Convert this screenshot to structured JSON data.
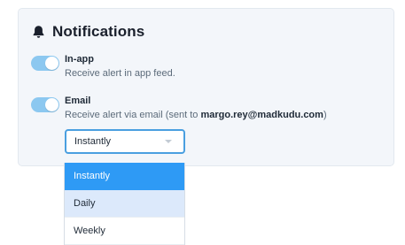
{
  "notifications": {
    "title": "Notifications",
    "title_icon": "bell-icon",
    "inapp": {
      "label": "In-app",
      "description": "Receive alert in app feed.",
      "enabled": true
    },
    "email": {
      "label": "Email",
      "description_prefix": "Receive alert via email (sent to ",
      "address": "margo.rey@madkudu.com",
      "description_suffix": ")",
      "enabled": true
    },
    "frequency": {
      "selected": "Instantly",
      "options": [
        "Instantly",
        "Daily",
        "Weekly"
      ]
    }
  },
  "colors": {
    "toggle_on": "#8cc8f0",
    "select_border": "#4a9fe0",
    "option_selected": "#2e9af5",
    "option_hover": "#dce9fb",
    "card_bg": "#f3f6fa"
  }
}
